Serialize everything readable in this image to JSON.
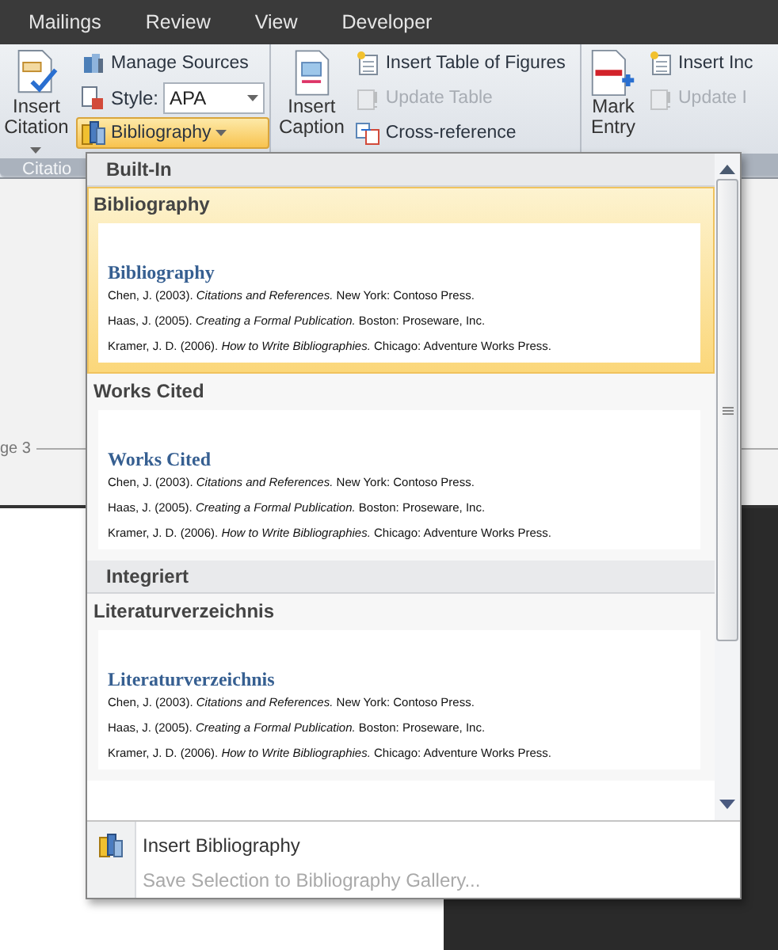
{
  "tabs": [
    {
      "label": "Mailings"
    },
    {
      "label": "Review"
    },
    {
      "label": "View"
    },
    {
      "label": "Developer"
    }
  ],
  "ribbon": {
    "groups": [
      {
        "label": "Citatio",
        "large": {
          "label": "Insert Citation",
          "caret": true
        },
        "small": [
          {
            "kind": "button",
            "label": "Manage Sources",
            "disabled": false
          },
          {
            "kind": "style",
            "label": "Style:",
            "value": "APA"
          },
          {
            "kind": "dropdown",
            "label": "Bibliography",
            "open": true
          }
        ]
      },
      {
        "large": {
          "label": "Insert Caption",
          "caret": false
        },
        "small": [
          {
            "kind": "button",
            "label": "Insert Table of Figures",
            "disabled": false
          },
          {
            "kind": "button",
            "label": "Update Table",
            "disabled": true
          },
          {
            "kind": "button",
            "label": "Cross-reference",
            "disabled": false
          }
        ]
      },
      {
        "large": {
          "label": "Mark Entry",
          "caret": false
        },
        "small": [
          {
            "kind": "button",
            "label": "Insert Inc",
            "disabled": false
          },
          {
            "kind": "button",
            "label": "Update I",
            "disabled": true
          }
        ]
      }
    ]
  },
  "document": {
    "page_label": "ge 3"
  },
  "menu": {
    "sections": [
      {
        "header": "Built-In",
        "items": [
          {
            "title": "Bibliography",
            "selected": true,
            "heading": "Bibliography",
            "entries": [
              "Chen, J. (2003). *Citations and References.* New York: Contoso Press.",
              "Haas, J. (2005). *Creating a Formal Publication.* Boston: Proseware, Inc.",
              "Kramer, J. D. (2006). *How to Write Bibliographies.* Chicago: Adventure Works Press."
            ]
          },
          {
            "title": "Works Cited",
            "selected": false,
            "heading": "Works Cited",
            "entries": [
              "Chen, J. (2003). *Citations and References.* New York: Contoso Press.",
              "Haas, J. (2005). *Creating a Formal Publication.* Boston: Proseware, Inc.",
              "Kramer, J. D. (2006). *How to Write Bibliographies.* Chicago: Adventure Works Press."
            ]
          }
        ]
      },
      {
        "header": "Integriert",
        "items": [
          {
            "title": "Literaturverzeichnis",
            "selected": false,
            "heading": "Literaturverzeichnis",
            "entries": [
              "Chen, J. (2003). *Citations and References.* New York: Contoso Press.",
              "Haas, J. (2005). *Creating a Formal Publication.* Boston: Proseware, Inc.",
              "Kramer, J. D. (2006). *How to Write Bibliographies.* Chicago: Adventure Works Press."
            ]
          }
        ]
      }
    ],
    "footer": [
      {
        "label": "Insert Bibliography",
        "disabled": false
      },
      {
        "label": "Save Selection to Bibliography Gallery...",
        "disabled": true
      }
    ]
  }
}
